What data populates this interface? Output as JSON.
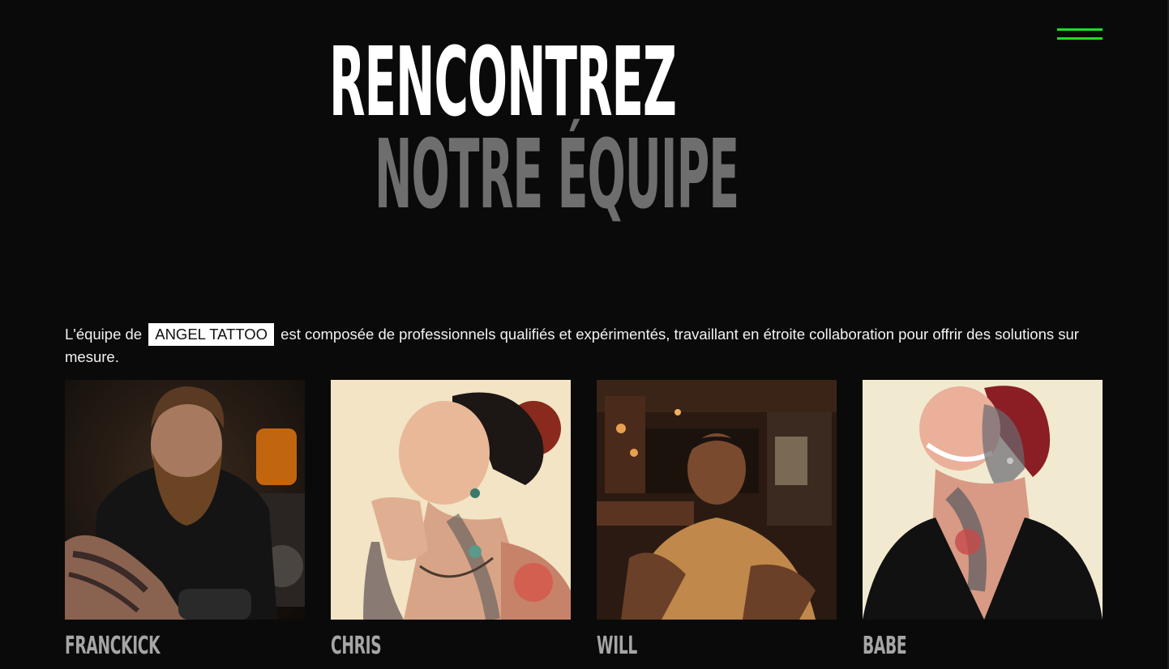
{
  "header": {
    "title_line1": "RENCONTREZ",
    "title_line2": "NOTRE ÉQUIPE",
    "menu_icon": "hamburger-menu-icon"
  },
  "intro": {
    "text_before": "L'équipe de",
    "brand": "ANGEL TATTOO",
    "text_after": "est composée de professionnels qualifiés et expérimentés, travaillant en étroite collaboration pour offrir des solutions sur mesure."
  },
  "team": [
    {
      "name": "FRANCKICK"
    },
    {
      "name": "CHRIS"
    },
    {
      "name": "WILL"
    },
    {
      "name": "BABE"
    }
  ],
  "colors": {
    "background": "#0a0a0a",
    "accent": "#22dd22",
    "title_primary": "#ffffff",
    "title_secondary": "#6e6e6e",
    "member_name": "#a6a6a6"
  }
}
